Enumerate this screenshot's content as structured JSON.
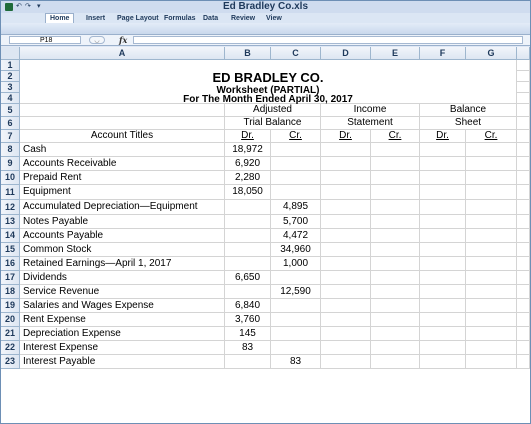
{
  "window": {
    "title": "Ed Bradley Co.xls",
    "qat": {
      "undo": "↶",
      "redo": "↷",
      "customize": "▾"
    }
  },
  "ribbon": {
    "tabs": [
      "Home",
      "Insert",
      "Page Layout",
      "Formulas",
      "Data",
      "Review",
      "View"
    ],
    "active_tab": "Home"
  },
  "formula_bar": {
    "name_box": "P18",
    "cancel_symbol": "◡",
    "fx_label": "fx",
    "value": ""
  },
  "sheet": {
    "columns": [
      "A",
      "B",
      "C",
      "D",
      "E",
      "F",
      "G"
    ],
    "row_numbers": [
      "1",
      "2",
      "3",
      "4",
      "5",
      "6",
      "7",
      "8",
      "9",
      "10",
      "11",
      "12",
      "13",
      "14",
      "15",
      "16",
      "17",
      "18",
      "19",
      "20",
      "21",
      "22",
      "23"
    ],
    "heading": {
      "company": "ED BRADLEY CO.",
      "report": "Worksheet (PARTIAL)",
      "period": "For The Month Ended April 30, 2017"
    },
    "group_headers": {
      "trial_1": "Adjusted",
      "trial_2": "Trial Balance",
      "income_1": "Income",
      "income_2": "Statement",
      "balance_1": "Balance",
      "balance_2": "Sheet"
    },
    "column_titles": {
      "account": "Account Titles",
      "dr": "Dr.",
      "cr": "Cr."
    },
    "accounts": [
      {
        "title": "Cash",
        "dr": "18,972",
        "cr": ""
      },
      {
        "title": "Accounts Receivable",
        "dr": "6,920",
        "cr": ""
      },
      {
        "title": "Prepaid Rent",
        "dr": "2,280",
        "cr": ""
      },
      {
        "title": "Equipment",
        "dr": "18,050",
        "cr": ""
      },
      {
        "title": "Accumulated Depreciation—Equipment",
        "dr": "",
        "cr": "4,895"
      },
      {
        "title": "Notes Payable",
        "dr": "",
        "cr": "5,700"
      },
      {
        "title": "Accounts Payable",
        "dr": "",
        "cr": "4,472"
      },
      {
        "title": "Common Stock",
        "dr": "",
        "cr": "34,960"
      },
      {
        "title": "Retained Earnings—April 1, 2017",
        "dr": "",
        "cr": "1,000"
      },
      {
        "title": "Dividends",
        "dr": "6,650",
        "cr": ""
      },
      {
        "title": "Service Revenue",
        "dr": "",
        "cr": "12,590"
      },
      {
        "title": "Salaries and Wages Expense",
        "dr": "6,840",
        "cr": ""
      },
      {
        "title": "Rent Expense",
        "dr": "3,760",
        "cr": ""
      },
      {
        "title": "Depreciation Expense",
        "dr": "145",
        "cr": ""
      },
      {
        "title": "Interest Expense",
        "dr": "83",
        "cr": ""
      },
      {
        "title": "Interest Payable",
        "dr": "",
        "cr": "83"
      }
    ]
  }
}
